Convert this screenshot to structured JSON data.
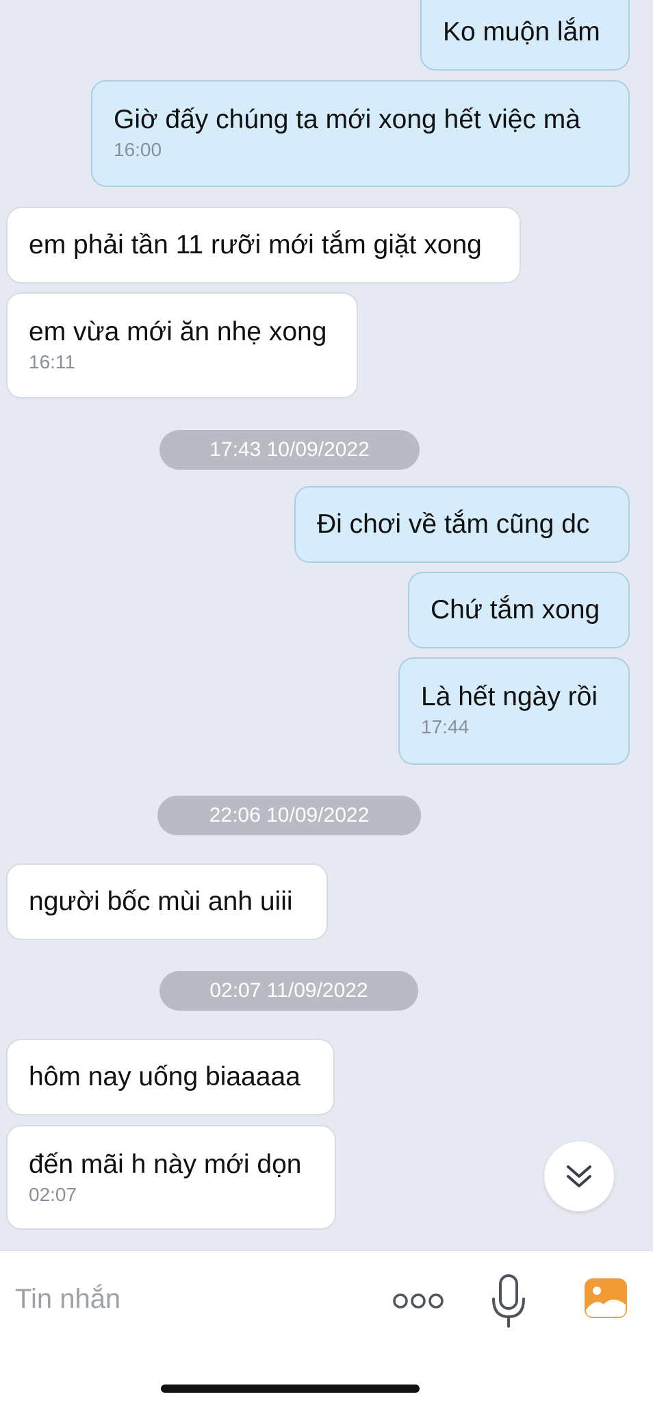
{
  "messages": [
    {
      "dir": "out",
      "text": "Ko muộn lắm"
    },
    {
      "dir": "out",
      "text": "Giờ đấy chúng ta mới xong hết việc mà",
      "time": "16:00"
    },
    {
      "dir": "in",
      "text": "em phải tần 11 rưỡi mới tắm giặt xong"
    },
    {
      "dir": "in",
      "text": "em vừa mới ăn nhẹ xong",
      "time": "16:11"
    },
    {
      "dir": "out",
      "text": "Đi chơi về tắm cũng dc"
    },
    {
      "dir": "out",
      "text": "Chứ tắm xong"
    },
    {
      "dir": "out",
      "text": "Là hết ngày rồi",
      "time": "17:44"
    },
    {
      "dir": "in",
      "text": "người bốc mùi anh uiii"
    },
    {
      "dir": "in",
      "text": "hôm nay uống biaaaaa"
    },
    {
      "dir": "in",
      "text": "đến mãi h này mới dọn",
      "time": "02:07"
    }
  ],
  "separators": [
    "17:43 10/09/2022",
    "22:06 10/09/2022",
    "02:07 11/09/2022"
  ],
  "composer": {
    "placeholder": "Tin nhắn",
    "icons": [
      "more-icon",
      "microphone-icon",
      "image-icon"
    ]
  },
  "scroll_button": {
    "icon": "double-chevron-down-icon"
  },
  "colors": {
    "background": "#e6e8f2",
    "outgoing_bubble": "#d6ecfb",
    "incoming_bubble": "#ffffff",
    "separator": "#b9bbc4",
    "image_icon": "#f29c38"
  }
}
